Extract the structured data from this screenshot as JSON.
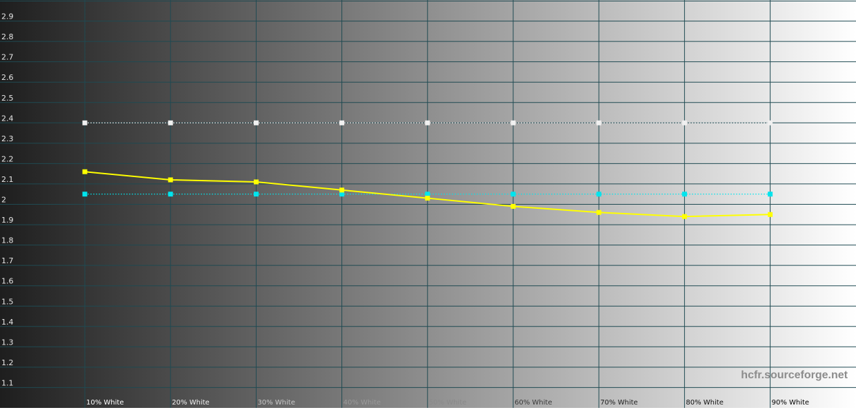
{
  "chart_data": {
    "type": "line",
    "title": "",
    "xlabel": "",
    "ylabel": "",
    "ylim": [
      1.0,
      3.0
    ],
    "yticks": [
      1.1,
      1.2,
      1.3,
      1.4,
      1.5,
      1.6,
      1.7,
      1.8,
      1.9,
      2,
      2.1,
      2.2,
      2.3,
      2.4,
      2.5,
      2.6,
      2.7,
      2.8,
      2.9
    ],
    "ytick_labels": [
      "1.1",
      "1.2",
      "1.3",
      "1.4",
      "1.5",
      "1.6",
      "1.7",
      "1.8",
      "1.9",
      "2",
      "2.1",
      "2.2",
      "2.3",
      "2.4",
      "2.5",
      "2.6",
      "2.7",
      "2.8",
      "2.9"
    ],
    "categories": [
      "10% White",
      "20% White",
      "30% White",
      "40% White",
      "50% White",
      "60% White",
      "70% White",
      "80% White",
      "90% White"
    ],
    "grid": true,
    "series": [
      {
        "values": [
          2.16,
          2.12,
          2.11,
          2.07,
          2.03,
          1.99,
          1.96,
          1.94,
          1.95
        ],
        "color": "#ffff00",
        "style": "solid",
        "marker": "square"
      },
      {
        "values": [
          2.4,
          2.4,
          2.4,
          2.4,
          2.4,
          2.4,
          2.4,
          2.4,
          2.4
        ],
        "color": "#f0f0f0",
        "style": "dotted",
        "marker": "square"
      },
      {
        "values": [
          2.05,
          2.05,
          2.05,
          2.05,
          2.05,
          2.05,
          2.05,
          2.05,
          2.05
        ],
        "color": "#00e5ee",
        "style": "dotted",
        "marker": "square"
      }
    ],
    "background": {
      "type": "gradient",
      "from": "#1e1e1e",
      "to": "#ffffff"
    },
    "grid_color": "#1f4a52",
    "watermark": "hcfr.sourceforge.net"
  }
}
